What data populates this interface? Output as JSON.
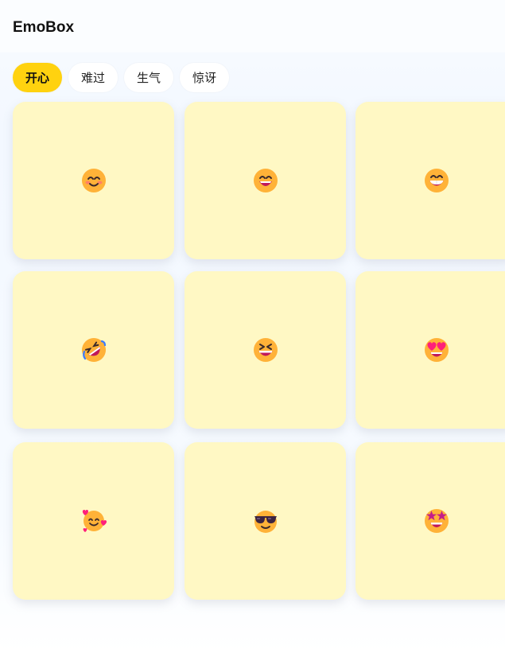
{
  "app": {
    "title": "EmoBox"
  },
  "tabs": [
    {
      "label": "开心",
      "active": true
    },
    {
      "label": "难过",
      "active": false
    },
    {
      "label": "生气",
      "active": false
    },
    {
      "label": "惊讶",
      "active": false
    }
  ],
  "emojis": [
    {
      "name": "smiling-face-with-smiling-eyes"
    },
    {
      "name": "grinning-face-with-smiling-eyes"
    },
    {
      "name": "beaming-face-with-smiling-eyes"
    },
    {
      "name": "rolling-on-the-floor-laughing"
    },
    {
      "name": "grinning-squinting-face"
    },
    {
      "name": "smiling-face-with-heart-eyes"
    },
    {
      "name": "smiling-face-with-hearts"
    },
    {
      "name": "smiling-face-with-sunglasses"
    },
    {
      "name": "star-struck"
    }
  ],
  "colors": {
    "accent": "#ffd20f",
    "card": "#fff8c4",
    "face": "#ffb238",
    "heart": "#ff1f7a",
    "mouth": "#c0185a"
  }
}
